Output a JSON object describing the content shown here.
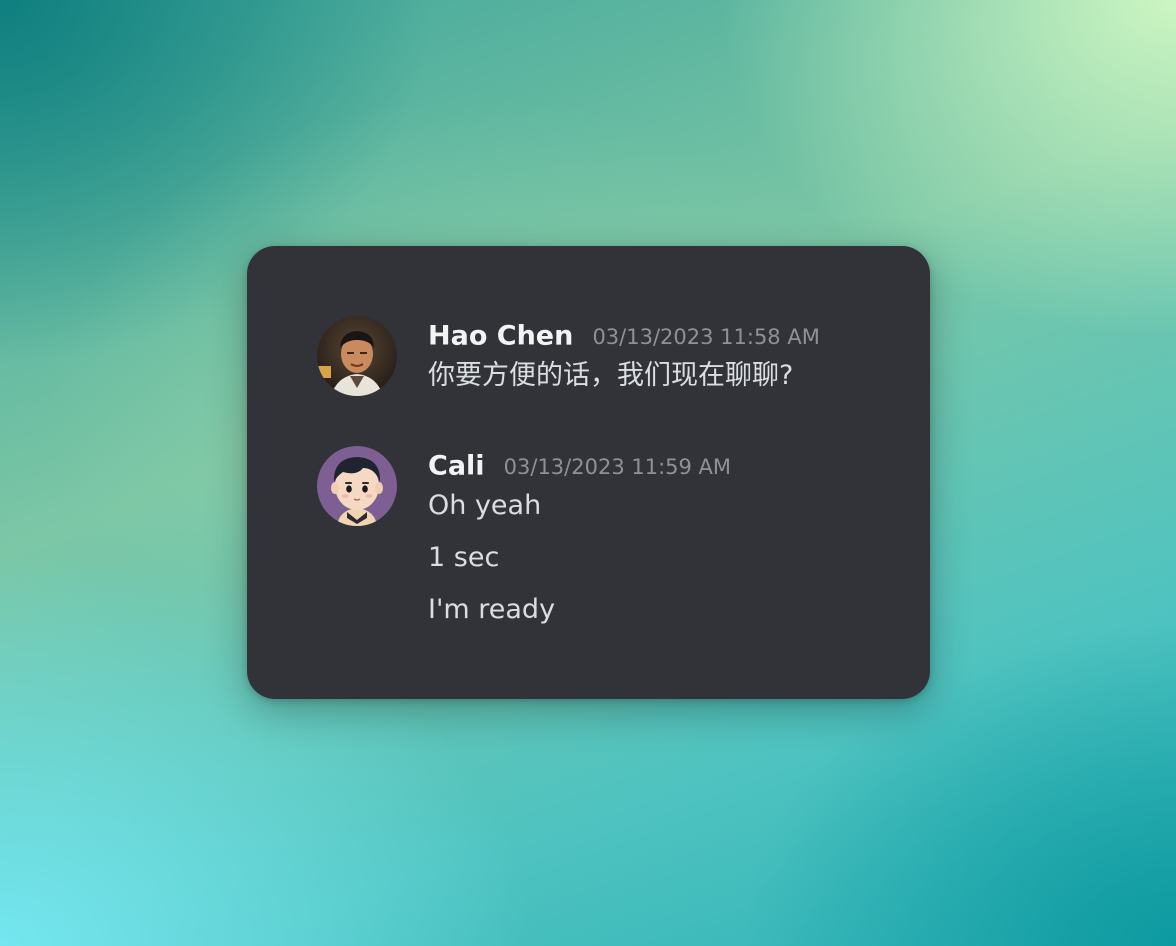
{
  "background": {
    "colors": {
      "top_left": "#0f7f7f",
      "top_right": "#cdf6c2",
      "bottom_left": "#74e6ef",
      "bottom_right": "#0d9aa0",
      "card": "#313338"
    }
  },
  "messages": [
    {
      "username": "Hao Chen",
      "timestamp": "03/13/2023 11:58 AM",
      "avatar_icon": "photo-avatar-icon",
      "lines": [
        "你要方便的话，我们现在聊聊?"
      ]
    },
    {
      "username": "Cali",
      "timestamp": "03/13/2023 11:59 AM",
      "avatar_icon": "cartoon-avatar-icon",
      "lines": [
        "Oh yeah",
        "1 sec",
        "I'm ready"
      ]
    }
  ]
}
